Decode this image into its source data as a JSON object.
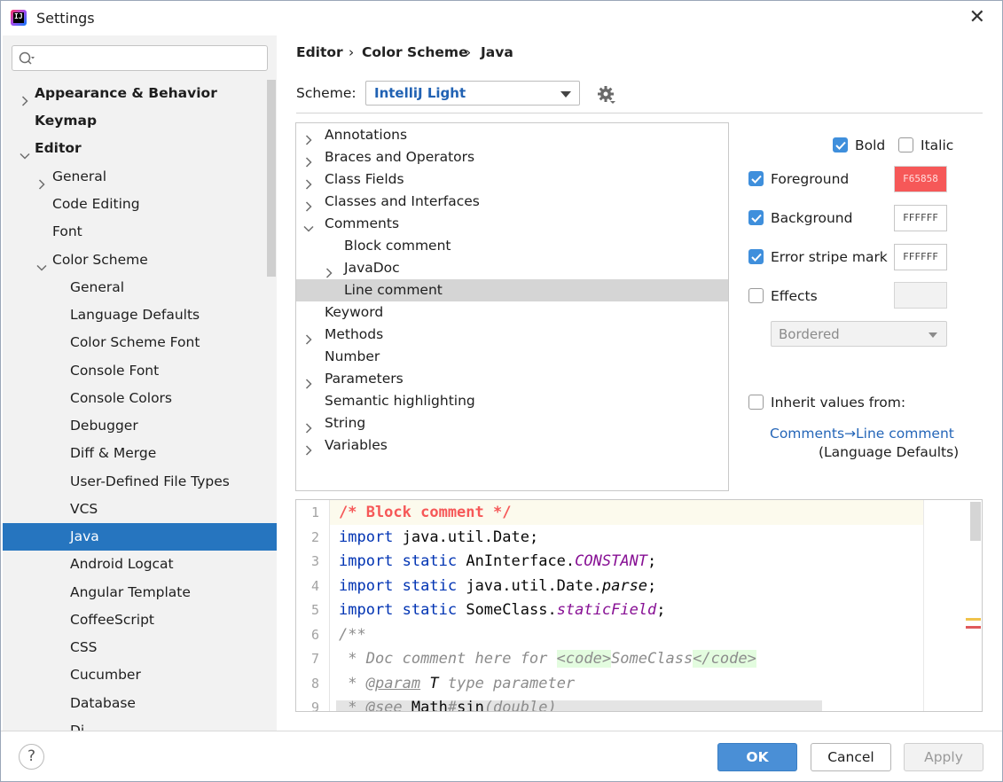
{
  "window": {
    "title": "Settings",
    "close_glyph": "✕"
  },
  "sidebar": {
    "search_placeholder": "",
    "items": [
      {
        "label": "Appearance & Behavior"
      },
      {
        "label": "Keymap"
      },
      {
        "label": "Editor"
      },
      {
        "label": "General"
      },
      {
        "label": "Code Editing"
      },
      {
        "label": "Font"
      },
      {
        "label": "Color Scheme"
      },
      {
        "label": "General"
      },
      {
        "label": "Language Defaults"
      },
      {
        "label": "Color Scheme Font"
      },
      {
        "label": "Console Font"
      },
      {
        "label": "Console Colors"
      },
      {
        "label": "Debugger"
      },
      {
        "label": "Diff & Merge"
      },
      {
        "label": "User-Defined File Types"
      },
      {
        "label": "VCS"
      },
      {
        "label": "Java"
      },
      {
        "label": "Android Logcat"
      },
      {
        "label": "Angular Template"
      },
      {
        "label": "CoffeeScript"
      },
      {
        "label": "CSS"
      },
      {
        "label": "Cucumber"
      },
      {
        "label": "Database"
      },
      {
        "label": "Di..."
      }
    ]
  },
  "breadcrumb": {
    "items": [
      "Editor",
      "Color Scheme",
      "Java"
    ],
    "separator": "›"
  },
  "scheme": {
    "label": "Scheme:",
    "value": "IntelliJ Light"
  },
  "attributes": [
    {
      "label": "Annotations"
    },
    {
      "label": "Braces and Operators"
    },
    {
      "label": "Class Fields"
    },
    {
      "label": "Classes and Interfaces"
    },
    {
      "label": "Comments"
    },
    {
      "label": "Block comment"
    },
    {
      "label": "JavaDoc"
    },
    {
      "label": "Line comment"
    },
    {
      "label": "Keyword"
    },
    {
      "label": "Methods"
    },
    {
      "label": "Number"
    },
    {
      "label": "Parameters"
    },
    {
      "label": "Semantic highlighting"
    },
    {
      "label": "String"
    },
    {
      "label": "Variables"
    }
  ],
  "options": {
    "bold": {
      "label": "Bold",
      "checked": true
    },
    "italic": {
      "label": "Italic",
      "checked": false
    },
    "foreground": {
      "label": "Foreground",
      "checked": true,
      "color": "F65858"
    },
    "background": {
      "label": "Background",
      "checked": true,
      "color": "FFFFFF"
    },
    "error_stripe": {
      "label": "Error stripe mark",
      "checked": true,
      "color": "FFFFFF"
    },
    "effects": {
      "label": "Effects",
      "checked": false,
      "style": "Bordered"
    },
    "inherit": {
      "label": "Inherit values from:",
      "checked": false,
      "link": "Comments→Line comment",
      "note": "(Language Defaults)"
    }
  },
  "preview": {
    "line_numbers": [
      "1",
      "2",
      "3",
      "4",
      "5",
      "6",
      "7",
      "8",
      "9"
    ],
    "lines": [
      {
        "parts": [
          [
            "/* Block comment */",
            "cm-red"
          ]
        ]
      },
      {
        "parts": [
          [
            "import",
            "kw"
          ],
          [
            " java.util.Date;",
            ""
          ]
        ]
      },
      {
        "parts": [
          [
            "import",
            "kw"
          ],
          [
            " ",
            ""
          ],
          [
            "static",
            "kw"
          ],
          [
            " AnInterface.",
            ""
          ],
          [
            "CONSTANT",
            "const"
          ],
          [
            ";",
            ""
          ]
        ]
      },
      {
        "parts": [
          [
            "import",
            "kw"
          ],
          [
            " ",
            ""
          ],
          [
            "static",
            "kw"
          ],
          [
            " java.util.Date.",
            ""
          ],
          [
            "parse",
            "plain-it"
          ],
          [
            ";",
            ""
          ]
        ]
      },
      {
        "parts": [
          [
            "import",
            "kw"
          ],
          [
            " ",
            ""
          ],
          [
            "static",
            "kw"
          ],
          [
            " SomeClass.",
            ""
          ],
          [
            "staticField",
            "const"
          ],
          [
            ";",
            ""
          ]
        ]
      },
      {
        "parts": [
          [
            "/**",
            "doc"
          ]
        ]
      },
      {
        "parts": [
          [
            " * Doc comment here for ",
            "doc"
          ],
          [
            "<code>",
            "tag"
          ],
          [
            "SomeClass",
            "doc"
          ],
          [
            "</code>",
            "tag"
          ]
        ]
      },
      {
        "parts": [
          [
            " * ",
            "doc"
          ],
          [
            "@param",
            "doc-u"
          ],
          [
            " ",
            "doc"
          ],
          [
            "T",
            "plain-it"
          ],
          [
            " type parameter",
            "doc"
          ]
        ]
      },
      {
        "parts": [
          [
            " * @see ",
            "doc"
          ],
          [
            "Math",
            ""
          ],
          [
            "#",
            "doc"
          ],
          [
            "sin",
            ""
          ],
          [
            "(double)",
            "doc"
          ]
        ]
      }
    ]
  },
  "footer": {
    "help": "?",
    "ok": "OK",
    "cancel": "Cancel",
    "apply": "Apply"
  }
}
